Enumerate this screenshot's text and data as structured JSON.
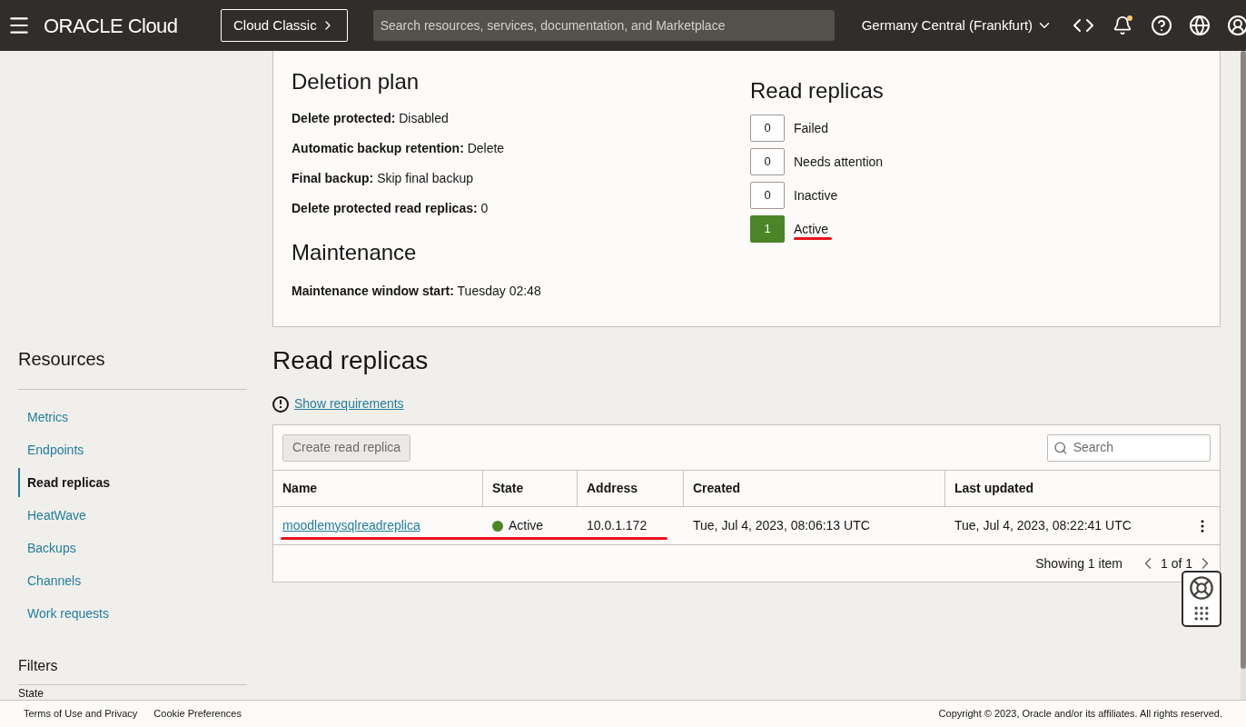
{
  "header": {
    "brand": "ORACLE Cloud",
    "classic_button": "Cloud Classic",
    "search": {
      "placeholder": "Search resources, services, documentation, and Marketplace"
    },
    "region": "Germany Central (Frankfurt)",
    "notification_dot": true
  },
  "details": {
    "deletion_plan": {
      "title": "Deletion plan",
      "fields": [
        {
          "label": "Delete protected:",
          "value": "Disabled"
        },
        {
          "label": "Automatic backup retention:",
          "value": "Delete"
        },
        {
          "label": "Final backup:",
          "value": "Skip final backup"
        },
        {
          "label": "Delete protected read replicas:",
          "value": "0"
        }
      ]
    },
    "maintenance": {
      "title": "Maintenance",
      "fields": [
        {
          "label": "Maintenance window start:",
          "value": "Tuesday 02:48"
        }
      ]
    },
    "read_replicas_summary": {
      "title": "Read replicas",
      "counts": [
        {
          "count": "0",
          "label": "Failed",
          "highlighted": false,
          "annotated": false
        },
        {
          "count": "0",
          "label": "Needs attention",
          "highlighted": false,
          "annotated": false
        },
        {
          "count": "0",
          "label": "Inactive",
          "highlighted": false,
          "annotated": false
        },
        {
          "count": "1",
          "label": "Active",
          "highlighted": true,
          "annotated": true
        }
      ]
    }
  },
  "sidebar": {
    "title": "Resources",
    "items": [
      {
        "label": "Metrics",
        "selected": false
      },
      {
        "label": "Endpoints",
        "selected": false
      },
      {
        "label": "Read replicas",
        "selected": true
      },
      {
        "label": "HeatWave",
        "selected": false
      },
      {
        "label": "Backups",
        "selected": false
      },
      {
        "label": "Channels",
        "selected": false
      },
      {
        "label": "Work requests",
        "selected": false
      }
    ],
    "filters_title": "Filters",
    "filter_label": "State"
  },
  "read_replicas": {
    "title": "Read replicas",
    "requirements_link": "Show requirements",
    "create_button": "Create read replica",
    "search": {
      "placeholder": "Search"
    },
    "table": {
      "columns": [
        "Name",
        "State",
        "Address",
        "Created",
        "Last updated"
      ],
      "rows": [
        {
          "name": "moodlemysqlreadreplica",
          "state": "Active",
          "color": "#4c8527",
          "address": "10.0.1.172",
          "created": "Tue, Jul 4, 2023, 08:06:13 UTC",
          "updated": "Tue, Jul 4, 2023, 08:22:41 UTC",
          "annotated": true
        }
      ]
    },
    "pagination": {
      "summary": "Showing 1 item",
      "page": "1 of 1"
    }
  },
  "footer": {
    "links": [
      "Terms of Use and Privacy",
      "Cookie Preferences"
    ],
    "copyright": "Copyright © 2023, Oracle and/or its affiliates. All rights reserved."
  }
}
